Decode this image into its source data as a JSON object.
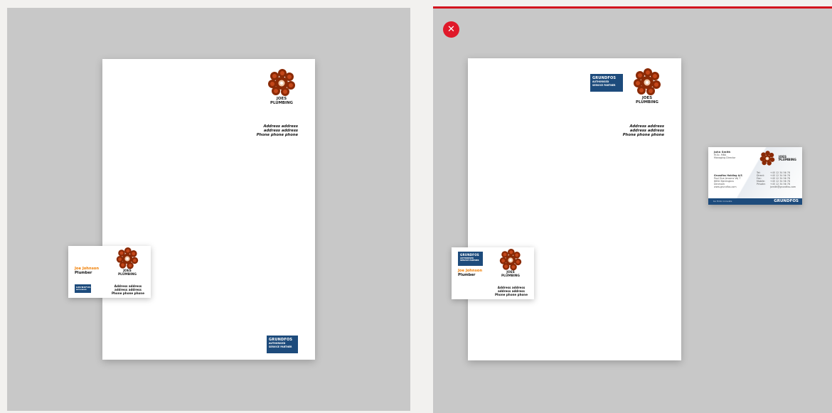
{
  "colors": {
    "accent_red": "#e0192a",
    "grundfos_blue": "#1d4b7c",
    "name_orange": "#f07d00",
    "logo_brown": "#8a2a06"
  },
  "close_button": {
    "icon": "close-icon",
    "glyph": "✕"
  },
  "company": {
    "name_line1": "JOES",
    "name_line2": "PLUMBING",
    "address": [
      "Address address",
      "address address",
      "Phone phone phone"
    ]
  },
  "badge": {
    "brand": "GRUNDFOS",
    "subtitle_line1": "AUTHORISED",
    "subtitle_line2": "SERVICE PARTNER"
  },
  "business_card": {
    "person_name": "Joe Johnson",
    "role": "Plumber"
  },
  "grundfos_card": {
    "person_name": "John Smith",
    "person_title1": "M.Sc. MBA",
    "person_title2": "Managing Director",
    "company_name": "Grundfos Holding A/S",
    "address": [
      "Poul Due Jensens Vej 7",
      "8850 Bjerringbro",
      "Denmark",
      "www.grundfos.com"
    ],
    "contact_labels": [
      "Tel:",
      "Direct:",
      "Fax:",
      "Mobile:",
      "Private:"
    ],
    "contact_values": [
      "+45 12 34 56 78",
      "+45 12 34 56 78",
      "+45 12 34 56 78",
      "+45 12 34 56 78",
      "+45 12 34 56 78",
      "jsmith@grundfos.com"
    ],
    "footer_left": "be think innovate",
    "footer_brand": "GRUNDFOS"
  }
}
